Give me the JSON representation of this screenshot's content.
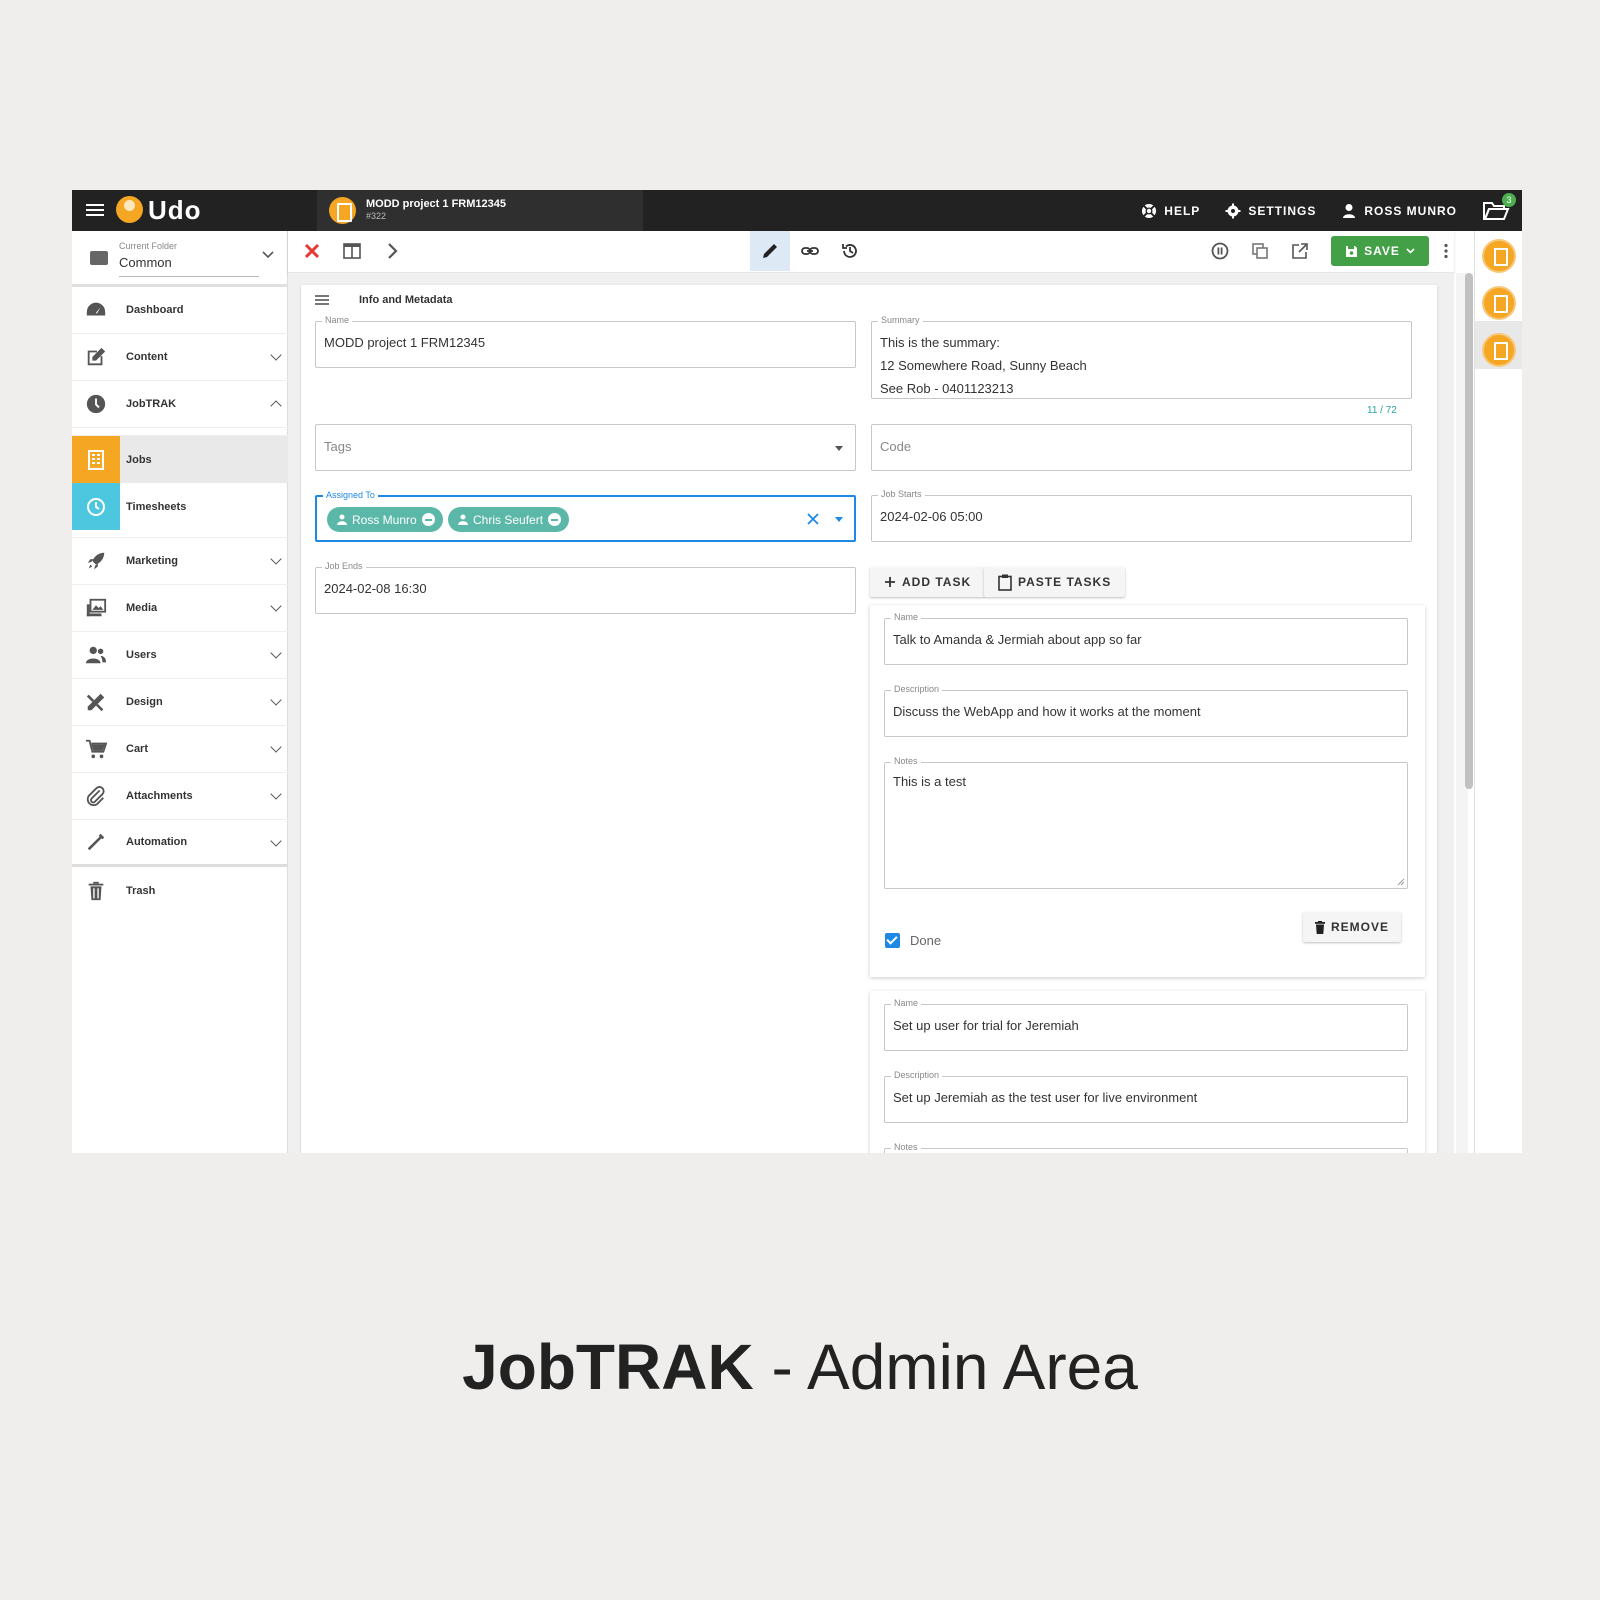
{
  "app": {
    "logo": "Udo",
    "doc_tab": {
      "title": "MODD project 1 FRM12345",
      "id": "#322"
    },
    "help": "HELP",
    "settings": "SETTINGS",
    "user": "ROSS MUNRO",
    "folder_badge": "3"
  },
  "sidebar": {
    "folder_label": "Current Folder",
    "folder_value": "Common",
    "items": {
      "dashboard": "Dashboard",
      "content": "Content",
      "jobtrak": "JobTRAK",
      "jobs": "Jobs",
      "timesheets": "Timesheets",
      "marketing": "Marketing",
      "media": "Media",
      "users": "Users",
      "design": "Design",
      "cart": "Cart",
      "attachments": "Attachments",
      "automation": "Automation",
      "trash": "Trash"
    }
  },
  "toolbar": {
    "save_label": "SAVE"
  },
  "form": {
    "section_title": "Info and Metadata",
    "name_label": "Name",
    "name_value": "MODD project 1 FRM12345",
    "summary_label": "Summary",
    "summary_lines": [
      "This is the summary:",
      "12 Somewhere Road, Sunny Beach",
      "See Rob - 0401123213"
    ],
    "summary_counter": "11 / 72",
    "tags_placeholder": "Tags",
    "code_placeholder": "Code",
    "assigned_label": "Assigned To",
    "assigned": [
      "Ross Munro",
      "Chris Seufert"
    ],
    "job_starts_label": "Job Starts",
    "job_starts_value": "2024-02-06 05:00",
    "job_ends_label": "Job Ends",
    "job_ends_value": "2024-02-08 16:30",
    "add_task": "ADD TASK",
    "paste_tasks": "PASTE TASKS"
  },
  "tasks": [
    {
      "name_label": "Name",
      "name": "Talk to Amanda & Jermiah about app so far",
      "description_label": "Description",
      "description": "Discuss the WebApp and how it works at the moment",
      "notes_label": "Notes",
      "notes": "This is a test",
      "done_label": "Done",
      "done": true,
      "remove": "REMOVE"
    },
    {
      "name_label": "Name",
      "name": "Set up user for trial for Jeremiah",
      "description_label": "Description",
      "description": "Set up Jeremiah as the test user for live environment",
      "notes_label": "Notes"
    }
  ],
  "footer": {
    "bold": "JobTRAK",
    "rest": " - Admin Area"
  },
  "colors": {
    "accent_orange": "#f5a623",
    "teal": "#4dc6df",
    "chip": "#5bb8a8",
    "save_green": "#43a047",
    "focus_blue": "#1e88e5",
    "topbar": "#222222"
  }
}
